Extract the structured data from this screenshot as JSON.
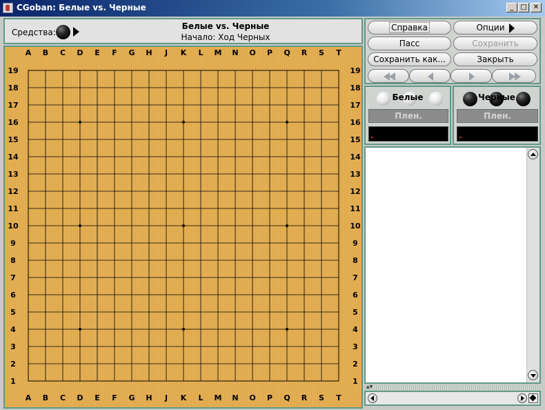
{
  "window": {
    "title": "CGoban: Белые vs. Черные",
    "controls": [
      "minimize-icon",
      "maximize-icon",
      "close-icon"
    ]
  },
  "info": {
    "means_label": "Средства:",
    "game_title": "Белые vs. Черные",
    "status": "Начало: Ход Черных"
  },
  "board": {
    "size": 19,
    "columns": [
      "A",
      "B",
      "C",
      "D",
      "E",
      "F",
      "G",
      "H",
      "J",
      "K",
      "L",
      "M",
      "N",
      "O",
      "P",
      "Q",
      "R",
      "S",
      "T"
    ],
    "rows": [
      "19",
      "18",
      "17",
      "16",
      "15",
      "14",
      "13",
      "12",
      "11",
      "10",
      "9",
      "8",
      "7",
      "6",
      "5",
      "4",
      "3",
      "2",
      "1"
    ],
    "star_points": [
      "D16",
      "K16",
      "Q16",
      "D10",
      "K10",
      "Q10",
      "D4",
      "K4",
      "Q4"
    ],
    "colors": {
      "wood": "#e3ad4e",
      "line": "#000000",
      "frame": "#5e9a88"
    }
  },
  "buttons": {
    "help": "Справка",
    "options": "Опции",
    "pass": "Пасс",
    "save": "Сохранить",
    "save_as": "Сохранить как...",
    "close": "Закрыть",
    "nav": [
      "rewind-to-start-icon",
      "step-back-icon",
      "step-forward-icon",
      "forward-to-end-icon"
    ]
  },
  "players": {
    "white": {
      "name": "Белые",
      "captured_label": "Плен."
    },
    "black": {
      "name": "Черные",
      "captured_label": "Плен."
    }
  },
  "chat": {
    "lines": []
  }
}
